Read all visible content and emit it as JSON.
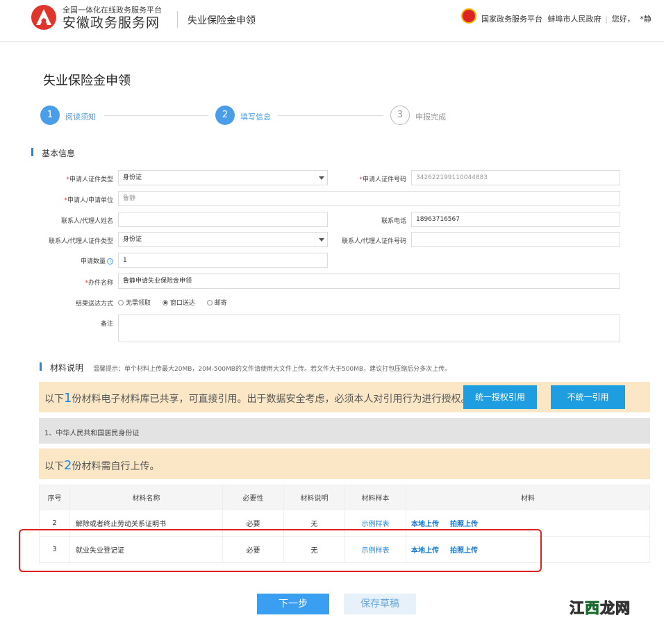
{
  "header": {
    "site_sub": "全国一体化在线政务服务平台",
    "site_name": "安徽政务服务网",
    "page_name": "失业保险金申领",
    "links": [
      "国家政务服务平台",
      "蚌埠市人民政府"
    ],
    "greeting": "您好，",
    "user": "*静"
  },
  "page_title": "失业保险金申领",
  "steps": [
    {
      "num": "1",
      "label": "阅读须知"
    },
    {
      "num": "2",
      "label": "填写信息"
    },
    {
      "num": "3",
      "label": "申报完成"
    }
  ],
  "basic": {
    "title": "基本信息",
    "id_type_label": "申请人证件类型",
    "id_type_value": "身份证",
    "id_no_label": "申请人证件号码",
    "id_no_value": "342622199110044883",
    "applicant_label": "申请人/申请单位",
    "applicant_value": "鲁静",
    "contact_name_label": "联系人/代理人姓名",
    "contact_name_value": "",
    "phone_label": "联系电话",
    "phone_value": "18963716567",
    "contact_id_type_label": "联系人/代理人证件类型",
    "contact_id_type_value": "身份证",
    "contact_id_no_label": "联系人/代理人证件号码",
    "contact_id_no_value": "",
    "qty_label": "申请数量",
    "qty_info": "i",
    "qty_value": "1",
    "case_name_label": "办件名称",
    "case_name_value": "鲁静申请失业保险金申领",
    "delivery_label": "结果送达方式",
    "delivery_options": [
      "无需领取",
      "窗口送达",
      "邮寄"
    ],
    "remark_label": "备注",
    "remark_value": ""
  },
  "materials": {
    "title": "材料说明",
    "tip": "温馨提示：单个材料上传最大20MB，20M-500MB的文件请使用大文件上传。若文件大于500MB，建议打包压缩后分多次上传。",
    "shared_pre": "以下",
    "shared_num": "1",
    "shared_post": "份材料电子材料库已共享，可直接引用。出于数据安全考虑，必须本人对引用行为进行授权。",
    "btn_auth": "统一授权引用",
    "btn_noauth": "不统一引用",
    "shared_item": "1、中华人民共和国居民身份证",
    "self_pre": "以下",
    "self_num": "2",
    "self_post": "份材料需自行上传。",
    "table_headers": [
      "序号",
      "材料名称",
      "必要性",
      "材料说明",
      "材料样本",
      "材料"
    ],
    "rows": [
      {
        "no": "2",
        "name": "解除或者终止劳动关系证明书",
        "required": "必要",
        "desc": "无",
        "sample": "示例样表",
        "local": "本地上传",
        "photo": "拍照上传"
      },
      {
        "no": "3",
        "name": "就业失业登记证",
        "required": "必要",
        "desc": "无",
        "sample": "示例样表",
        "local": "本地上传",
        "photo": "拍照上传"
      }
    ]
  },
  "actions": {
    "next": "下一步",
    "save": "保存草稿"
  },
  "watermark": {
    "a": "江",
    "b": "西",
    "c": "龙网"
  }
}
